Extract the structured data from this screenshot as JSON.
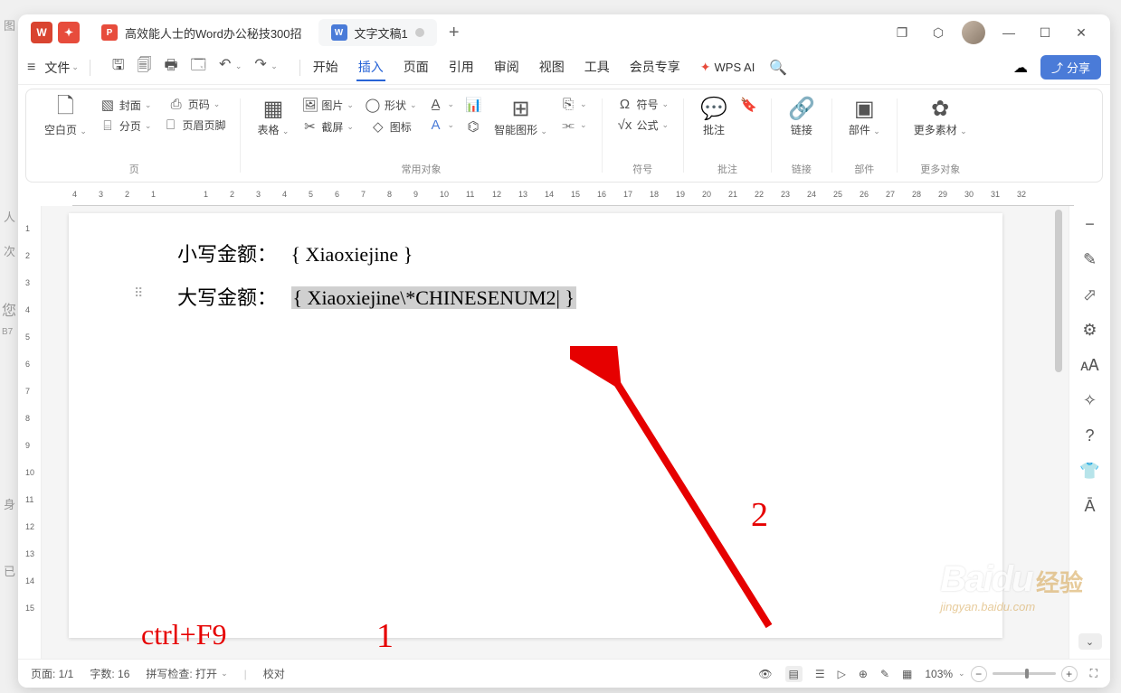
{
  "tabs": [
    {
      "icon": "P",
      "label": "高效能人士的Word办公秘技300招"
    },
    {
      "icon": "W",
      "label": "文字文稿1"
    }
  ],
  "window": {
    "min": "—",
    "max": "☐",
    "close": "✕"
  },
  "menu": {
    "file": "文件",
    "tabs": [
      "开始",
      "插入",
      "页面",
      "引用",
      "审阅",
      "视图",
      "工具",
      "会员专享"
    ],
    "active": "插入",
    "wpsai": "WPS AI",
    "share": "分享"
  },
  "ribbon": {
    "blank": "空白页",
    "cover": "封面",
    "pagenum": "页码",
    "pagebreak": "分页",
    "headerfooter": "页眉页脚",
    "table": "表格",
    "picture": "图片",
    "shape": "形状",
    "screenshot": "截屏",
    "icon": "图标",
    "textbox_a": "A",
    "chart": "⊞",
    "smartart": "智能图形",
    "more1": "⎘",
    "symbol": "符号",
    "formula": "公式",
    "comment": "批注",
    "bookmark": "❏",
    "link": "链接",
    "parts": "部件",
    "moreassets": "更多素材",
    "groups": {
      "page": "页",
      "objects": "常用对象",
      "symbol": "符号",
      "comment": "批注",
      "link": "链接",
      "parts": "部件",
      "assets": "更多对象"
    }
  },
  "ruler": {
    "marks": [
      4,
      3,
      2,
      1,
      "",
      1,
      2,
      3,
      4,
      5,
      6,
      7,
      8,
      9,
      10,
      11,
      12,
      13,
      14,
      15,
      16,
      17,
      18,
      19,
      20,
      21,
      22,
      23,
      24,
      25,
      26,
      27,
      28,
      29,
      30,
      31,
      32
    ]
  },
  "vruler": [
    1,
    2,
    3,
    4,
    5,
    6,
    7,
    8,
    9,
    10,
    11,
    12,
    13,
    14,
    15
  ],
  "doc": {
    "line1_label": "小写金额：",
    "line1_field": "{  Xiaoxiejine  }",
    "line2_label": "大写金额：",
    "line2_field": "{  Xiaoxiejine\\*CHINESENUM2|  }"
  },
  "annot": {
    "ctrl": "ctrl+F9",
    "one": "1",
    "two": "2"
  },
  "status": {
    "page": "页面: 1/1",
    "words": "字数: 16",
    "spell": "拼写检查: 打开",
    "proof": "校对",
    "zoom": "103%"
  },
  "watermark": {
    "main": "Bai",
    "du": "du",
    "cn": "经验",
    "sub": "jingyan.baidu.com"
  },
  "icons": {
    "cloud": "☁",
    "cube": "⬡",
    "search": "🔍",
    "eye": "👁",
    "list": "≡",
    "play": "▷",
    "globe": "⊕",
    "pen": "✎",
    "grid": "▦",
    "minus": "−",
    "plus": "+",
    "expand": "⛶",
    "book": "𖼊"
  }
}
